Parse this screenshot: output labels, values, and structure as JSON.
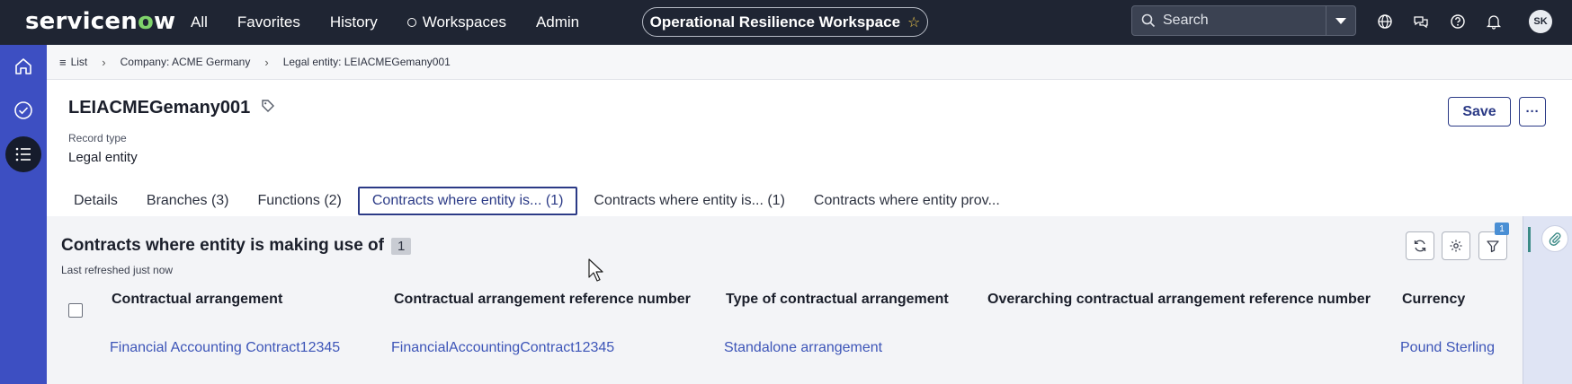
{
  "topbar": {
    "logo_text_a": "servicen",
    "logo_text_o": "o",
    "logo_text_b": "w",
    "nav": [
      "All",
      "Favorites",
      "History",
      "Workspaces",
      "Admin"
    ],
    "workspace": "Operational Resilience Workspace",
    "search_placeholder": "Search",
    "avatar_initials": "SK"
  },
  "breadcrumb": {
    "list": "List",
    "company": "Company: ACME Germany",
    "entity": "Legal entity: LEIACMEGemany001"
  },
  "record": {
    "title": "LEIACMEGemany001",
    "type_label": "Record type",
    "type_value": "Legal entity",
    "save_label": "Save",
    "more_label": "···"
  },
  "tabs": [
    "Details",
    "Branches (3)",
    "Functions (2)",
    "Contracts where entity is... (1)",
    "Contracts where entity is... (1)",
    "Contracts where entity prov..."
  ],
  "panel": {
    "title": "Contracts where entity is making use of",
    "count": "1",
    "refreshed": "Last refreshed just now",
    "filter_count": "1",
    "columns": [
      "Contractual arrangement",
      "Contractual arrangement reference number",
      "Type of contractual arrangement",
      "Overarching contractual arrangement reference number",
      "Currency"
    ],
    "rows": [
      [
        "Financial Accounting Contract12345",
        "FinancialAccountingContract12345",
        "Standalone arrangement",
        "",
        "Pound Sterling"
      ]
    ]
  },
  "colors": {
    "topbar": "#1f2533",
    "rail": "#3d4fc2",
    "accent": "#2b3a86",
    "link": "#3d55b8"
  }
}
